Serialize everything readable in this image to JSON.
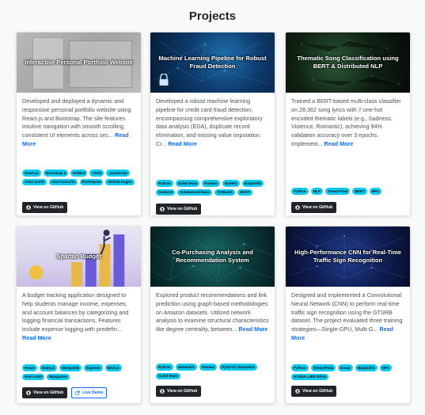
{
  "page": {
    "title": "Projects"
  },
  "cards": [
    {
      "image_title": "Interactive Personal Portfolio Website",
      "description": "Developed and deployed a dynamic and responsive personal portfolio website using React.js and Bootstrap. The site features intuitive navigation with smooth scrolling, consistent UI elements across sec...",
      "read_more": "Read More",
      "tags": [
        "React.js",
        "Bootstrap 5",
        "HTML5",
        "CSS3",
        "JavaScript",
        "react-scroll",
        "react-icons/fa",
        "Formspree",
        "GitHub Pages"
      ],
      "github_label": "View on GitHub"
    },
    {
      "image_title": "Machine Learning Pipeline for Robust Fraud Detection",
      "description": "Developed a robust machine learning pipeline for credit card fraud detection, encompassing comprehensive exploratory data analysis (EDA), duplicate record elimination, and missing value imputation. Cr...",
      "read_more": "Read More",
      "tags": [
        "Python",
        "Scikit-learn",
        "Pandas",
        "NumPy",
        "Matplotlib",
        "Seaborn",
        "Imbalanced-learn",
        "XGBoost",
        "SHAP"
      ],
      "github_label": "View on GitHub"
    },
    {
      "image_title": "Thematic Song Classification using BERT & Distributed NLP",
      "description": "Trained a BERT-based multi-class classifier on 28,362 song lyrics with 7 one-hot encoded thematic labels (e.g., Sadness, Violence, Romantic), achieving 94% validation accuracy over 3 epochs. Implement...",
      "read_more": "Read More",
      "tags": [
        "Python",
        "NLP",
        "TensorFlow",
        "BERT",
        "HPC"
      ],
      "github_label": "View on GitHub"
    },
    {
      "image_title": "Spartan Budget",
      "description": "A budget tracking application designed to help students manage income, expenses, and account balances by categorizing and logging financial transactions. Features include expense logging with predefin...",
      "read_more": "Read More",
      "tags": [
        "React",
        "Node.js",
        "MongoDB",
        "Express",
        "Next.js",
        "Next-Auth",
        "Mongoose"
      ],
      "github_label": "View on GitHub",
      "demo_label": "Live Demo"
    },
    {
      "image_title": "Co-Purchasing Analysis and Recommendation System",
      "description": "Explored product recommendations and link prediction using graph-based methodologies on Amazon datasets. Utilized network analysis to examine structural characteristics like degree centrality, between...",
      "read_more": "Read More",
      "tags": [
        "Python",
        "NetworkX",
        "Pandas",
        "PyTorch Geometric",
        "Scikit-learn"
      ],
      "github_label": "View on GitHub"
    },
    {
      "image_title": "High-Performance CNN for Real-Time Traffic Sign Recognition",
      "description": "Designed and implemented a Convolutional Neural Network (CNN) to perform real-time traffic sign recognition using the GTSRB dataset. The project evaluated three training strategies—Single-GPU, Multi-G...",
      "read_more": "Read More",
      "tags": [
        "Python",
        "TensorFlow",
        "Keras",
        "Matplotlib",
        "HPC",
        "NVIDIA L40S GPUs"
      ],
      "github_label": "View on GitHub"
    }
  ]
}
